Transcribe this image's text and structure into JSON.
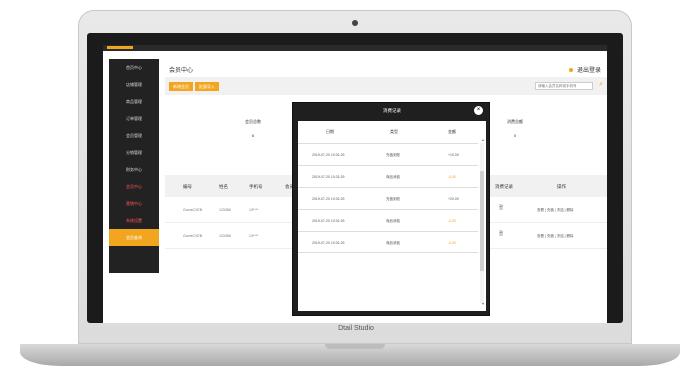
{
  "brand": {
    "label": "Dtail Studio"
  },
  "sidebar": {
    "items": [
      {
        "label": "首页中心"
      },
      {
        "label": "店铺管理"
      },
      {
        "label": "商品管理"
      },
      {
        "label": "订单管理"
      },
      {
        "label": "会员管理"
      },
      {
        "label": "分销管理"
      },
      {
        "label": "财务中心"
      },
      {
        "label": "会员中心"
      },
      {
        "label": "营销中心"
      },
      {
        "label": "系统设置"
      },
      {
        "label": "会员查询"
      }
    ]
  },
  "header": {
    "title": "会员中心",
    "logout": "退出登录"
  },
  "toolbar": {
    "btn1": "新增会员",
    "btn2": "批量导入",
    "search_placeholder": "请输入会员名称或手机号"
  },
  "stats": [
    {
      "label": "会员总数",
      "value": "6"
    },
    {
      "label": "今日新增",
      "value": "0"
    },
    {
      "label": "活跃会员",
      "value": "0"
    },
    {
      "label": "消费总额",
      "value": "0"
    }
  ],
  "table": {
    "headers": [
      "编号",
      "姓名",
      "手机号",
      "会员等级",
      "积分",
      "余额",
      "注册时间",
      "消费记录",
      "操作"
    ],
    "rows": [
      {
        "id": "GomeCVEB",
        "name": "123456",
        "phone": "13****",
        "ops": "查看 | 充值 | 冻结 | 删除"
      },
      {
        "id": "GomeCVEB",
        "name": "123456",
        "phone": "13****",
        "ops": "查看 | 充值 | 冻结 | 删除"
      }
    ]
  },
  "modal": {
    "title": "消费记录",
    "close": "×",
    "headers": [
      "日期",
      "类型",
      "金额"
    ],
    "rows": [
      {
        "date": "2019-07-20 10:31:29",
        "type": "充值到账",
        "amount": "+10.00"
      },
      {
        "date": "2019-07-20 10:31:29",
        "type": "商品消费",
        "amount": "-5.00"
      },
      {
        "date": "2019-07-20 10:31:29",
        "type": "充值到账",
        "amount": "+20.00"
      },
      {
        "date": "2019-07-20 10:31:29",
        "type": "商品消费",
        "amount": "-5.00"
      },
      {
        "date": "2019-07-20 10:31:29",
        "type": "商品消费",
        "amount": "-5.00"
      }
    ]
  },
  "colors": {
    "accent": "#f2a51f",
    "sidebar": "#222222",
    "modal_frame": "#1f1f1f"
  }
}
